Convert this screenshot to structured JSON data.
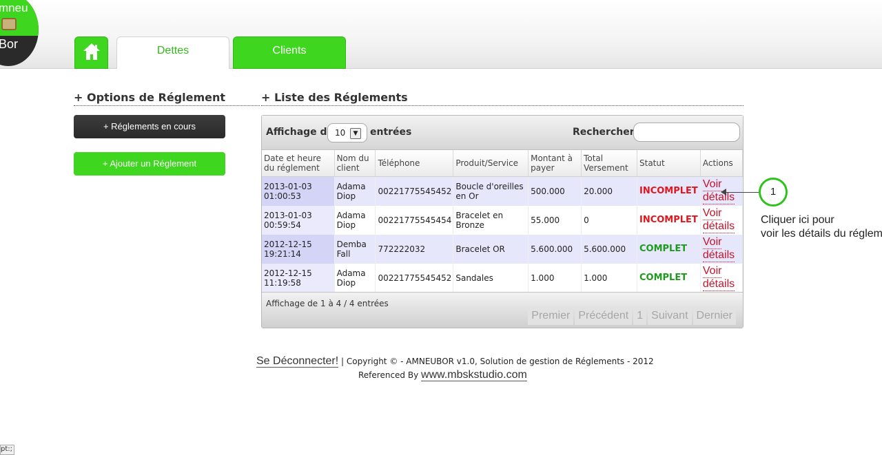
{
  "logo": {
    "line1": "mneu",
    "line2": "Bor"
  },
  "tabs": {
    "dettes": "Dettes",
    "clients": "Clients"
  },
  "left": {
    "title": "+ Options de Réglement",
    "btn_en_cours": "+ Réglements en cours",
    "btn_ajouter": "+ Ajouter un Réglement"
  },
  "right": {
    "title": "+ Liste des Réglements"
  },
  "toolbar": {
    "affichage": "Affichage de",
    "page_size": "10",
    "entrees": "entrées",
    "rechercher": "Rechercher:",
    "search_value": ""
  },
  "table": {
    "headers": [
      "Date et heure du réglement",
      "Nom du client",
      "Téléphone",
      "Produit/Service",
      "Montant à payer",
      "Total Versement",
      "Statut",
      "Actions"
    ],
    "rows": [
      {
        "date": "2013-01-03 01:00:53",
        "nom": "Adama Diop",
        "tel": "00221775545452",
        "produit": "Boucle d'oreilles en Or",
        "montant": "500.000",
        "versement": "20.000",
        "statut": "INCOMPLET",
        "action1": "Voir",
        "action2": "détails"
      },
      {
        "date": "2013-01-03 00:59:54",
        "nom": "Adama Diop",
        "tel": "00221775545454",
        "produit": "Bracelet en Bronze",
        "montant": "55.000",
        "versement": "0",
        "statut": "INCOMPLET",
        "action1": "Voir",
        "action2": "détails"
      },
      {
        "date": "2012-12-15 19:21:14",
        "nom": "Demba Fall",
        "tel": "772222032",
        "produit": "Bracelet OR",
        "montant": "5.600.000",
        "versement": "5.600.000",
        "statut": "COMPLET",
        "action1": "Voir",
        "action2": "détails"
      },
      {
        "date": "2012-12-15 11:19:58",
        "nom": "Adama Diop",
        "tel": "00221775545452",
        "produit": "Sandales",
        "montant": "1.000",
        "versement": "1.000",
        "statut": "COMPLET",
        "action1": "Voir",
        "action2": "détails"
      }
    ]
  },
  "pagination": {
    "info": "Affichage de 1 à 4 / 4 entrées",
    "premier": "Premier",
    "precedent": "Précédent",
    "page": "1",
    "suivant": "Suivant",
    "dernier": "Dernier"
  },
  "callout": {
    "number": "1",
    "line1": "Cliquer ici pour",
    "line2": "voir les détails du réglem"
  },
  "footer": {
    "logout": "Se Déconnecter!",
    "copyright": "| Copyright © - AMNEUBOR v1.0, Solution de gestion de Réglements - 2012",
    "referenced": "Referenced By",
    "studio": "www.mbskstudio.com"
  },
  "status_stub": "pt:;",
  "colors": {
    "accent_green": "#3fd61f",
    "incomplet_red": "#e0161c",
    "complet_green": "#1d9a1d",
    "link_red": "#c4142a"
  }
}
